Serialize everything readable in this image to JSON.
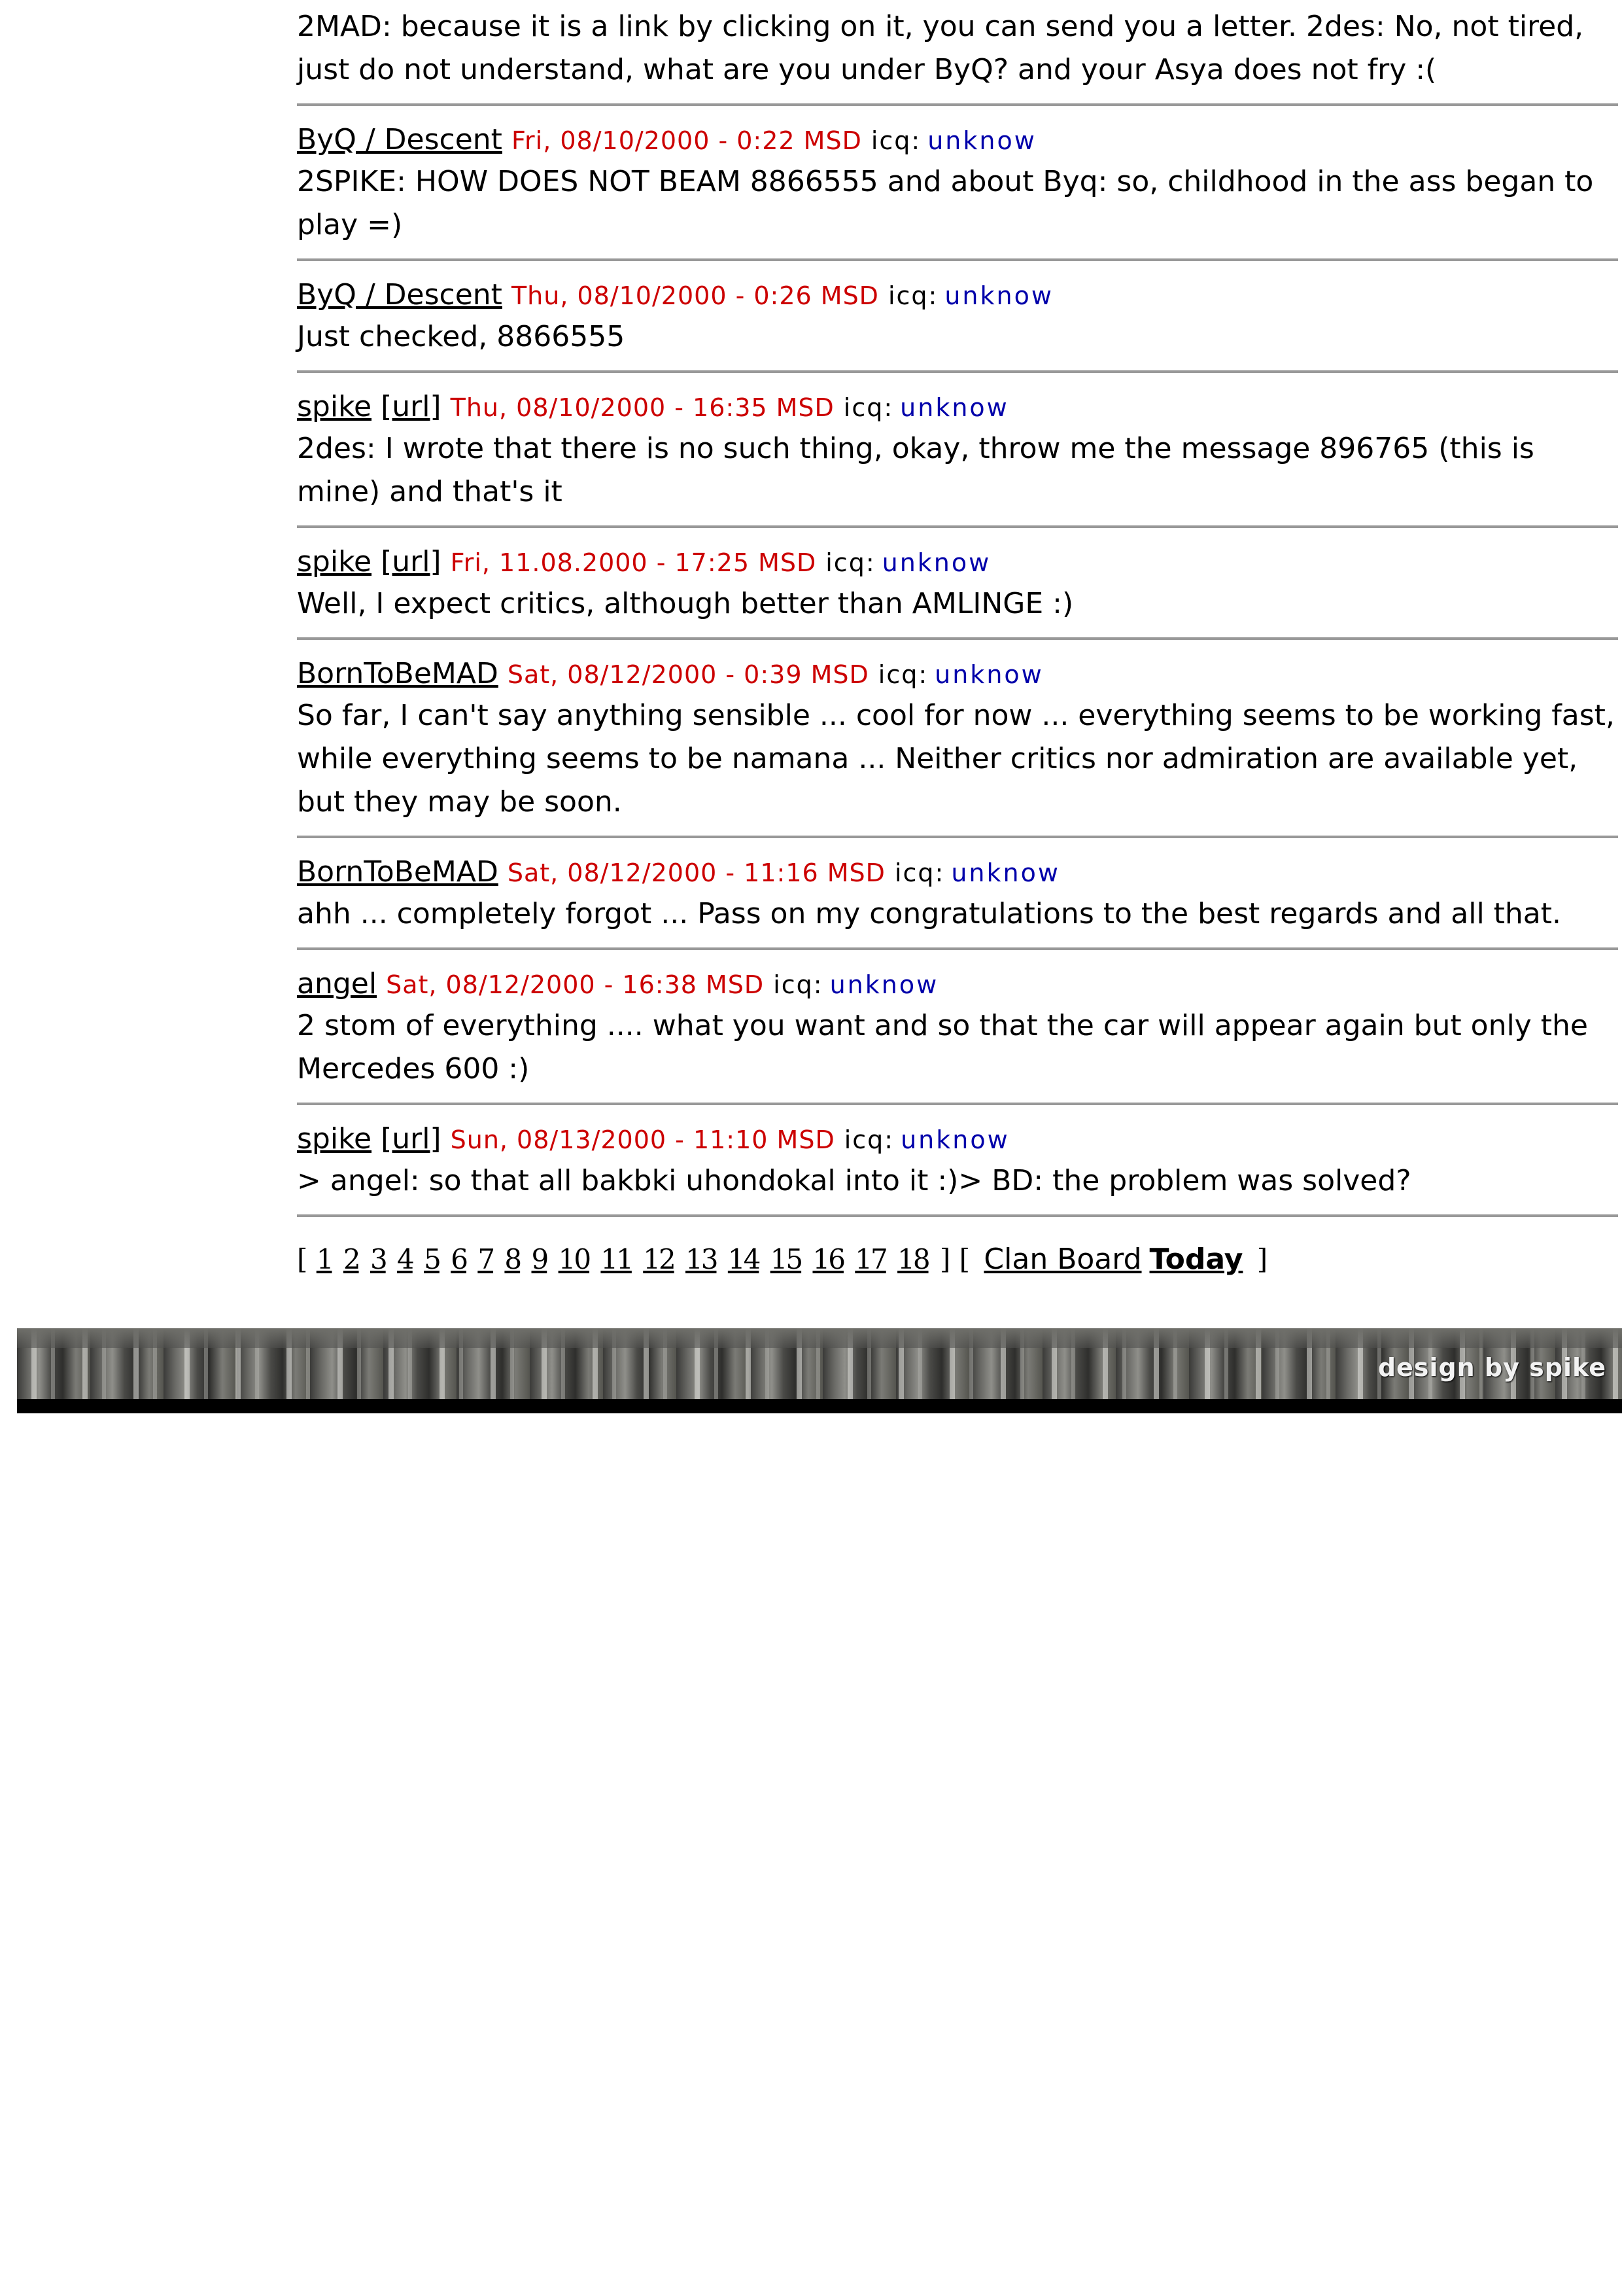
{
  "posts": [
    {
      "author": "",
      "url_label": "",
      "date": "",
      "icq_label": "",
      "icq": "",
      "body": "2MAD: because it is a link by clicking on it, you can send you a letter. 2des: No, not tired, just do not understand, what are you under ByQ? and your Asya does not fry :("
    },
    {
      "author": "ByQ / Descent",
      "url_label": "",
      "date": "Fri, 08/10/2000 - 0:22 MSD",
      "icq_label": "icq:",
      "icq": "unknow",
      "body": "2SPIKE: HOW DOES NOT BEAM 8866555 and about Byq: so, childhood in the ass began to play =)"
    },
    {
      "author": "ByQ / Descent",
      "url_label": "",
      "date": "Thu, 08/10/2000 - 0:26 MSD",
      "icq_label": "icq:",
      "icq": "unknow",
      "body": "Just checked, 8866555"
    },
    {
      "author": "spike",
      "url_label": "[url]",
      "date": "Thu, 08/10/2000 - 16:35 MSD",
      "icq_label": "icq:",
      "icq": "unknow",
      "body": "2des: I wrote that there is no such thing, okay, throw me the message 896765 (this is mine) and that's it"
    },
    {
      "author": "spike",
      "url_label": "[url]",
      "date": "Fri, 11.08.2000 - 17:25 MSD",
      "icq_label": "icq:",
      "icq": "unknow",
      "body": "Well, I expect critics, although better than AMLINGE :)"
    },
    {
      "author": "BornToBeMAD",
      "url_label": "",
      "date": "Sat, 08/12/2000 - 0:39 MSD",
      "icq_label": "icq:",
      "icq": "unknow",
      "body": "So far, I can't say anything sensible ... cool for now ... everything seems to be working fast, while everything seems to be namana ... Neither critics nor admiration are available yet, but they may be soon."
    },
    {
      "author": "BornToBeMAD",
      "url_label": "",
      "date": "Sat, 08/12/2000 - 11:16 MSD",
      "icq_label": "icq:",
      "icq": "unknow",
      "body": "ahh ... completely forgot ... Pass on my congratulations to the best regards and all that."
    },
    {
      "author": "angel",
      "url_label": "",
      "date": "Sat, 08/12/2000 - 16:38 MSD",
      "icq_label": "icq:",
      "icq": "unknow",
      "body": "2 stom of everything .... what you want and so that the car will appear again but only the Mercedes 600 :)"
    },
    {
      "author": "spike",
      "url_label": "[url]",
      "date": "Sun, 08/13/2000 - 11:10 MSD",
      "icq_label": "icq:",
      "icq": "unknow",
      "body": "> angel: so that all bakbki uhondokal into it :)> BD: the problem was solved?"
    }
  ],
  "pager": {
    "open_bracket": "[",
    "pages": [
      "1",
      "2",
      "3",
      "4",
      "5",
      "6",
      "7",
      "8",
      "9",
      "10",
      "11",
      "12",
      "13",
      "14",
      "15",
      "16",
      "17",
      "18"
    ],
    "close_bracket": "]",
    "open_bracket_2": "[",
    "clan_board_label": "Clan Board",
    "today_label": "Today",
    "close_bracket_2": "]"
  },
  "footer": {
    "credit": "design by spike"
  },
  "colors": {
    "date": "#cc0000",
    "icq_value": "#0000aa",
    "divider": "#999999"
  }
}
